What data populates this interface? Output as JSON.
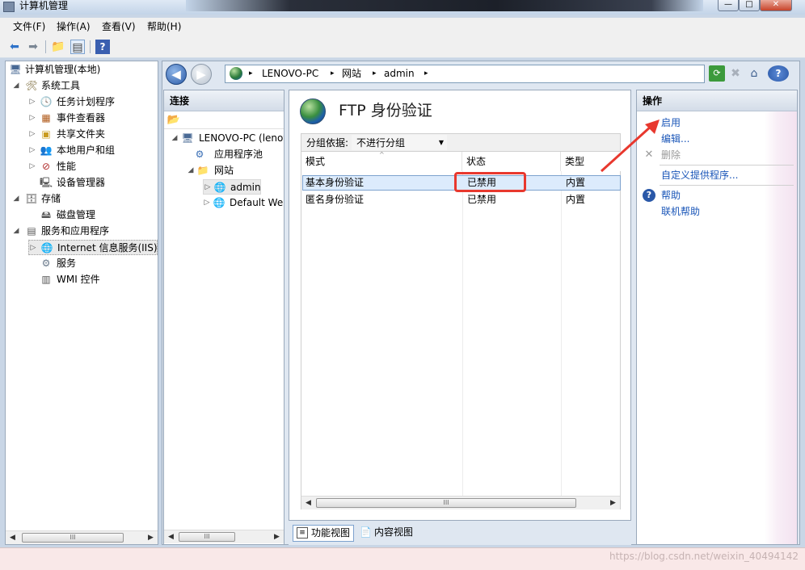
{
  "window": {
    "title": "计算机管理",
    "controls": [
      "—",
      "□",
      "✕"
    ]
  },
  "menubar": {
    "items": [
      "文件(F)",
      "操作(A)",
      "查看(V)",
      "帮助(H)"
    ]
  },
  "toolbar": {
    "icons": [
      "back-arrow-icon",
      "forward-arrow-icon",
      "up-folder-icon",
      "show-hide-tree-icon",
      "help-book-icon"
    ]
  },
  "tree": {
    "items": [
      {
        "label": "计算机管理(本地)",
        "icon": "computer-icon"
      },
      {
        "label": "系统工具",
        "icon": "tools-icon"
      },
      {
        "label": "任务计划程序",
        "icon": "clock-icon"
      },
      {
        "label": "事件查看器",
        "icon": "event-viewer-icon"
      },
      {
        "label": "共享文件夹",
        "icon": "shared-folder-icon"
      },
      {
        "label": "本地用户和组",
        "icon": "users-icon"
      },
      {
        "label": "性能",
        "icon": "performance-icon"
      },
      {
        "label": "设备管理器",
        "icon": "device-manager-icon"
      },
      {
        "label": "存储",
        "icon": "storage-icon"
      },
      {
        "label": "磁盘管理",
        "icon": "disk-icon"
      },
      {
        "label": "服务和应用程序",
        "icon": "services-apps-icon"
      },
      {
        "label": "Internet 信息服务(IIS)管",
        "icon": "iis-icon"
      },
      {
        "label": "服务",
        "icon": "gear-icon"
      },
      {
        "label": "WMI 控件",
        "icon": "wmi-icon"
      }
    ],
    "scroll_thumb": "III"
  },
  "iis": {
    "address": {
      "crumbs": [
        "LENOVO-PC",
        "网站",
        "admin"
      ],
      "separator": "▸"
    },
    "connections": {
      "title": "连接",
      "items": [
        {
          "label": "LENOVO-PC (lenovo",
          "icon": "server-icon"
        },
        {
          "label": "应用程序池",
          "icon": "app-pool-icon"
        },
        {
          "label": "网站",
          "icon": "sites-folder-icon"
        },
        {
          "label": "admin",
          "icon": "globe-icon"
        },
        {
          "label": "Default Web",
          "icon": "globe-icon"
        }
      ]
    },
    "feature": {
      "title": "FTP 身份验证",
      "group_label": "分组依据:",
      "group_value": "不进行分组",
      "columns": [
        "模式",
        "状态",
        "类型"
      ],
      "rows": [
        {
          "mode": "基本身份验证",
          "status": "已禁用",
          "type": "内置"
        },
        {
          "mode": "匿名身份验证",
          "status": "已禁用",
          "type": "内置"
        }
      ],
      "scroll_thumb": "III"
    },
    "view_tabs": [
      "功能视图",
      "内容视图"
    ],
    "actions": {
      "title": "操作",
      "items": [
        "启用",
        "编辑...",
        "删除",
        "自定义提供程序..."
      ],
      "help_items": [
        "帮助",
        "联机帮助"
      ]
    }
  },
  "watermark": "https://blog.csdn.net/weixin_40494142",
  "colors": {
    "link": "#1a56b8",
    "highlight": "#e8382e",
    "selection": "#dcebfc"
  }
}
